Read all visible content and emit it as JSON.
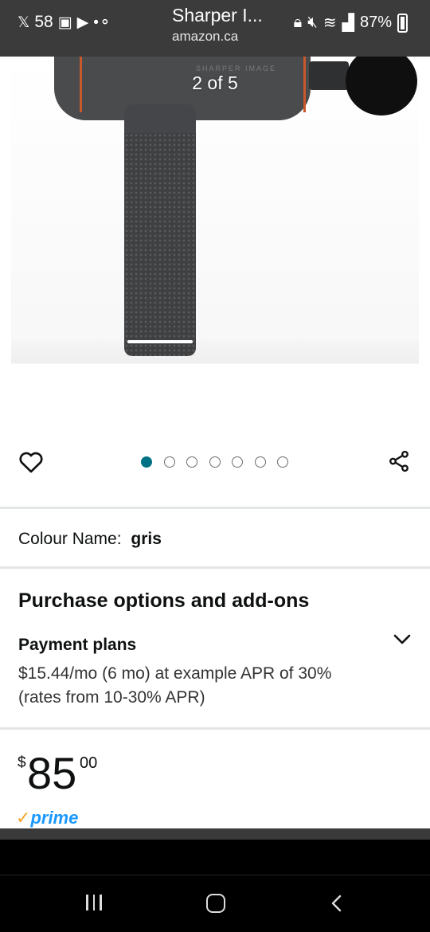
{
  "status_bar": {
    "time": "58",
    "app_title": "Sharper I...",
    "url": "amazon.ca",
    "battery": "87%"
  },
  "gallery": {
    "counter": "2 of 5",
    "product_brand_text": "SHARPER IMAGE",
    "dot_count": 7,
    "active_dot": 0
  },
  "product": {
    "colour_label": "Colour Name:",
    "colour_value": "gris",
    "purchase_title": "Purchase options and add-ons",
    "payment_title": "Payment plans",
    "payment_desc": "$15.44/mo (6 mo) at example APR of 30% (rates from 10-30% APR)",
    "price_symbol": "$",
    "price_whole": "85",
    "price_fraction": "00",
    "prime_text": "prime"
  },
  "colors": {
    "accent": "#007185",
    "prime_blue": "#1a98ff",
    "prime_check": "#f4a629",
    "status_bar_bg": "#3b3b3b"
  },
  "icons": {
    "wishlist": "heart-icon",
    "share": "share-icon",
    "expand": "chevron-down-icon"
  }
}
